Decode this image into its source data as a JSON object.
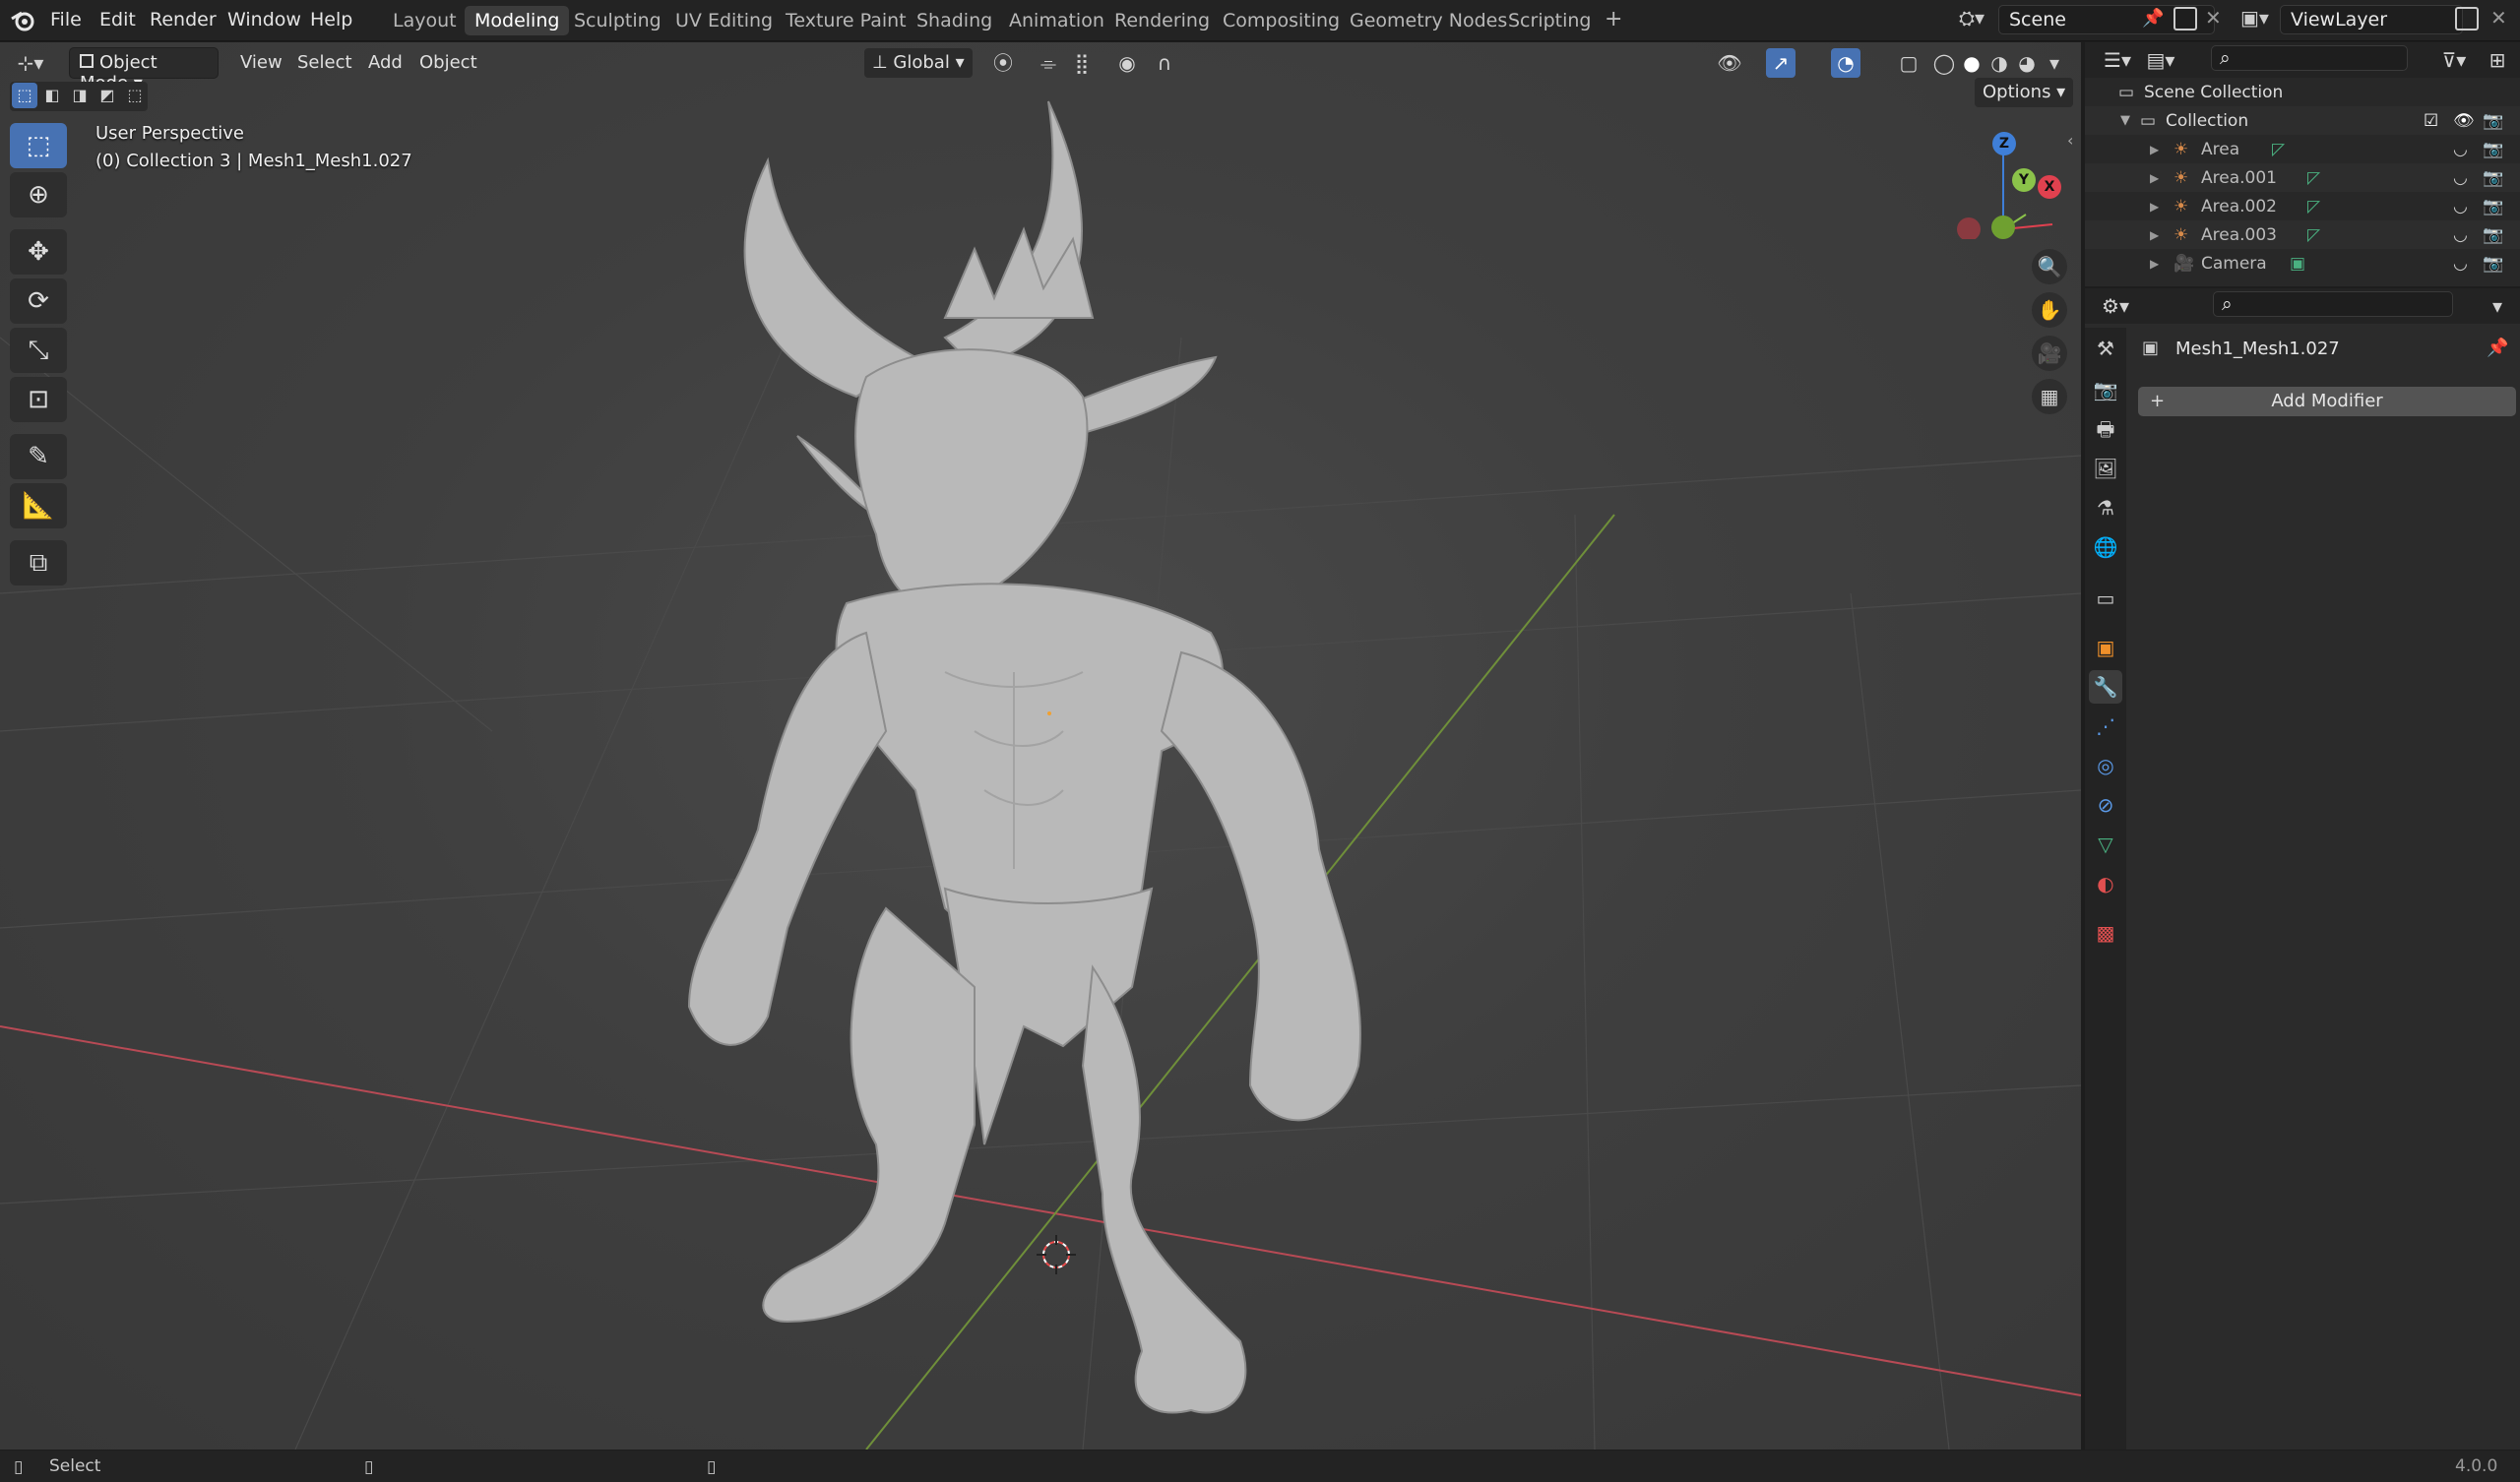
{
  "app": {
    "menus": [
      "File",
      "Edit",
      "Render",
      "Window",
      "Help"
    ],
    "workspaces": [
      "Layout",
      "Modeling",
      "Sculpting",
      "UV Editing",
      "Texture Paint",
      "Shading",
      "Animation",
      "Rendering",
      "Compositing",
      "Geometry Nodes",
      "Scripting"
    ],
    "active_workspace": "Modeling",
    "add_workspace_glyph": "+",
    "scene_name": "Scene",
    "view_layer": "ViewLayer"
  },
  "viewport": {
    "mode": "Object Mode",
    "menus": [
      "View",
      "Select",
      "Add",
      "Object"
    ],
    "transform_orientation": "Global",
    "options_label": "Options",
    "view_name": "User Perspective",
    "object_info": "(0) Collection 3 | Mesh1_Mesh1.027",
    "gizmo_axes": {
      "x": "X",
      "y": "Y",
      "z": "Z"
    }
  },
  "outliner": {
    "root": "Scene Collection",
    "collection": "Collection",
    "items": [
      {
        "name": "Area",
        "icon": "light-icon"
      },
      {
        "name": "Area.001",
        "icon": "light-icon"
      },
      {
        "name": "Area.002",
        "icon": "light-icon"
      },
      {
        "name": "Area.003",
        "icon": "light-icon"
      },
      {
        "name": "Camera",
        "icon": "camera-icon"
      }
    ]
  },
  "properties": {
    "object_name": "Mesh1_Mesh1.027",
    "add_modifier_label": "Add Modifier",
    "add_glyph": "+"
  },
  "statusbar": {
    "left_action": "Select",
    "version": "4.0.0"
  },
  "colors": {
    "accent": "#4772b3",
    "x_axis": "#e0414f",
    "y_axis": "#8bc34a",
    "z_axis": "#3f7fd8",
    "active_tab": "#3c3c3c"
  }
}
